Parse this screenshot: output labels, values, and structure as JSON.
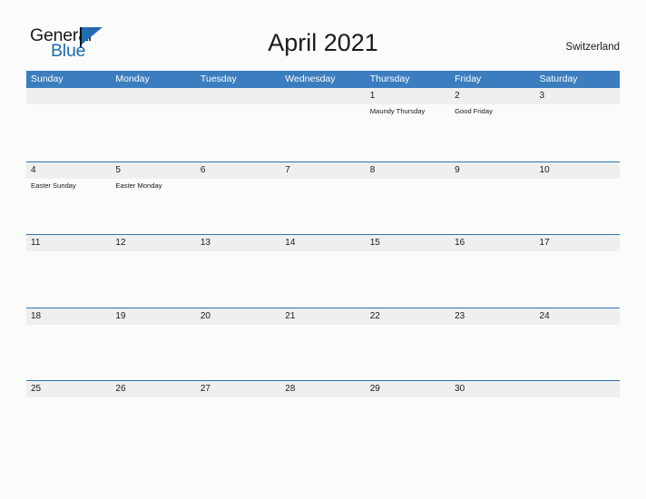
{
  "brand": {
    "name_part1": "General",
    "name_part2": "Blue",
    "flag_icon": "flag-triangle-icon"
  },
  "header": {
    "title": "April 2021",
    "locale": "Switzerland"
  },
  "colors": {
    "header_blue": "#3b7dbf",
    "row_rule_blue": "#2f74b5",
    "band_gray": "#efefef",
    "brand_blue": "#1f6cb0",
    "page_background": "#fbfbfb",
    "text": "#1a1a1a"
  },
  "calendar": {
    "month": "April",
    "year": "2021",
    "weekday_headers": [
      "Sunday",
      "Monday",
      "Tuesday",
      "Wednesday",
      "Thursday",
      "Friday",
      "Saturday"
    ],
    "weeks": [
      {
        "days": [
          {
            "date": "",
            "event": ""
          },
          {
            "date": "",
            "event": ""
          },
          {
            "date": "",
            "event": ""
          },
          {
            "date": "",
            "event": ""
          },
          {
            "date": "1",
            "event": "Maundy Thursday"
          },
          {
            "date": "2",
            "event": "Good Friday"
          },
          {
            "date": "3",
            "event": ""
          }
        ]
      },
      {
        "days": [
          {
            "date": "4",
            "event": "Easter Sunday"
          },
          {
            "date": "5",
            "event": "Easter Monday"
          },
          {
            "date": "6",
            "event": ""
          },
          {
            "date": "7",
            "event": ""
          },
          {
            "date": "8",
            "event": ""
          },
          {
            "date": "9",
            "event": ""
          },
          {
            "date": "10",
            "event": ""
          }
        ]
      },
      {
        "days": [
          {
            "date": "11",
            "event": ""
          },
          {
            "date": "12",
            "event": ""
          },
          {
            "date": "13",
            "event": ""
          },
          {
            "date": "14",
            "event": ""
          },
          {
            "date": "15",
            "event": ""
          },
          {
            "date": "16",
            "event": ""
          },
          {
            "date": "17",
            "event": ""
          }
        ]
      },
      {
        "days": [
          {
            "date": "18",
            "event": ""
          },
          {
            "date": "19",
            "event": ""
          },
          {
            "date": "20",
            "event": ""
          },
          {
            "date": "21",
            "event": ""
          },
          {
            "date": "22",
            "event": ""
          },
          {
            "date": "23",
            "event": ""
          },
          {
            "date": "24",
            "event": ""
          }
        ]
      },
      {
        "days": [
          {
            "date": "25",
            "event": ""
          },
          {
            "date": "26",
            "event": ""
          },
          {
            "date": "27",
            "event": ""
          },
          {
            "date": "28",
            "event": ""
          },
          {
            "date": "29",
            "event": ""
          },
          {
            "date": "30",
            "event": ""
          },
          {
            "date": "",
            "event": ""
          }
        ]
      }
    ]
  }
}
